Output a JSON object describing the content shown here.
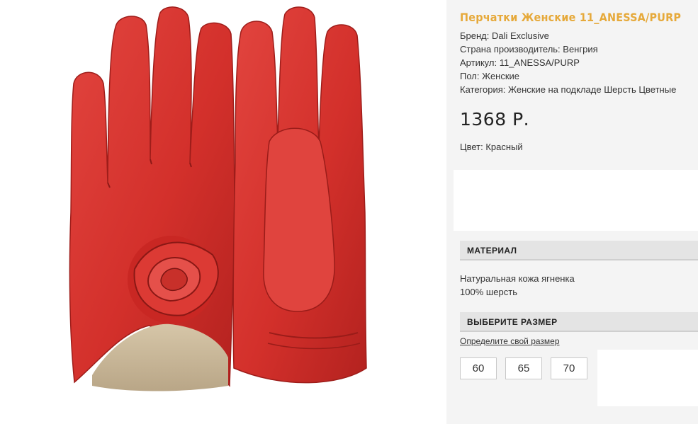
{
  "product": {
    "title": "Перчатки Женские 11_ANESSA/PURP",
    "meta": [
      "Бренд: Dali Exclusive",
      "Страна производитель: Венгрия",
      "Артикул: 11_ANESSA/PURP",
      "Пол: Женские",
      "Категория: Женские на подкладе Шерсть Цветные"
    ],
    "price": "1368 Р.",
    "color_line": "Цвет: Красный",
    "image_icon": "red-leather-gloves-image"
  },
  "material": {
    "heading": "МАТЕРИАЛ",
    "lines": [
      "Натуральная кожа ягненка",
      "100% шерсть"
    ]
  },
  "size": {
    "heading": "ВЫБЕРИТЕ РАЗМЕР",
    "link": "Определите свой размер",
    "options": [
      "60",
      "65",
      "70"
    ]
  },
  "colors": {
    "title": "#e6a93a",
    "glove": "#d6322d",
    "glove_dark": "#a8201d",
    "lining": "#c9b79a",
    "panel_bg": "#f4f4f4",
    "section_bg": "#e4e4e4"
  }
}
